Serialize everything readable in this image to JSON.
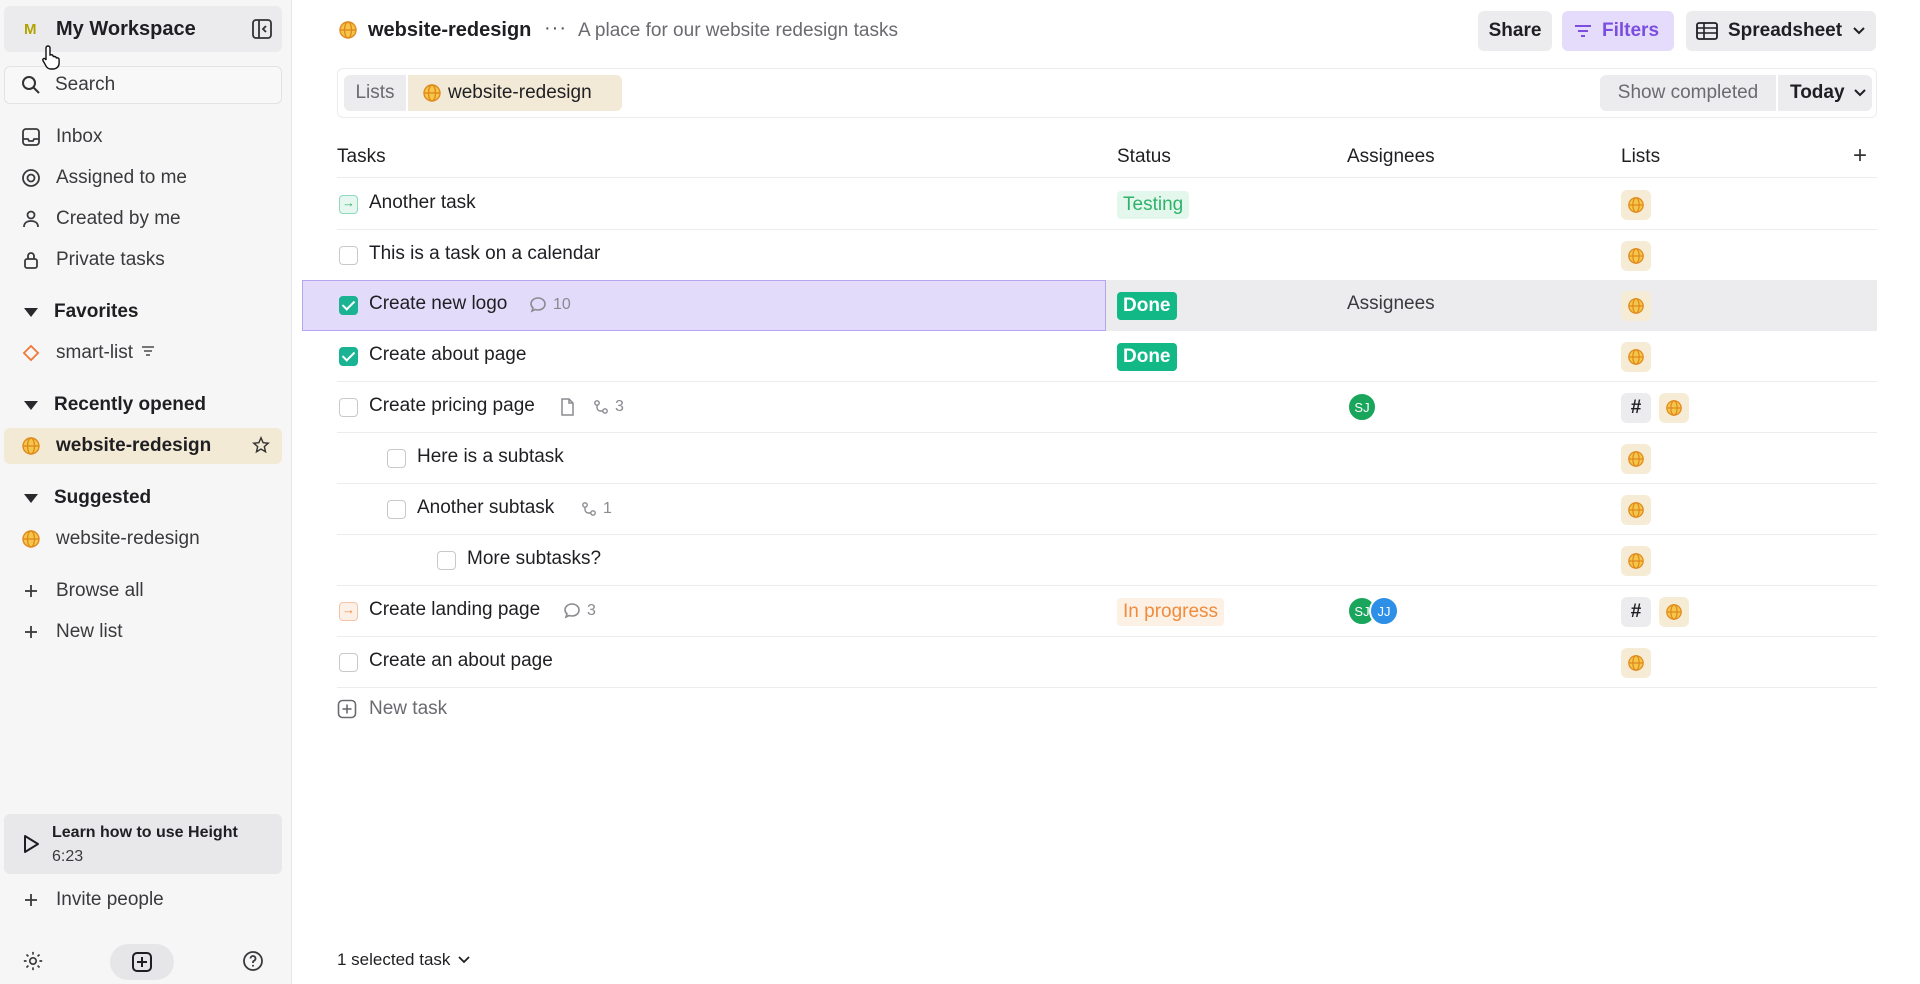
{
  "sidebar": {
    "workspace": {
      "avatar": "M",
      "name": "My Workspace"
    },
    "search": {
      "placeholder": "Search",
      "value": ""
    },
    "nav": [
      {
        "label": "Inbox",
        "icon": "inbox-icon"
      },
      {
        "label": "Assigned to me",
        "icon": "target-icon"
      },
      {
        "label": "Created by me",
        "icon": "person-icon"
      },
      {
        "label": "Private tasks",
        "icon": "lock-icon"
      }
    ],
    "favorites": {
      "title": "Favorites",
      "items": [
        {
          "label": "smart-list",
          "icon": "diamond-icon"
        }
      ]
    },
    "recent": {
      "title": "Recently opened",
      "items": [
        {
          "label": "website-redesign",
          "icon": "globe-icon"
        }
      ]
    },
    "suggested": {
      "title": "Suggested",
      "items": [
        {
          "label": "website-redesign",
          "icon": "globe-icon"
        }
      ]
    },
    "browse_all": "Browse all",
    "new_list": "New list",
    "learn": {
      "title": "Learn how to use Height",
      "duration": "6:23"
    },
    "invite": "Invite people"
  },
  "header": {
    "title": "website-redesign",
    "more": "···",
    "description": "A place for our website redesign tasks",
    "share": "Share",
    "filters": "Filters",
    "view": "Spreadsheet"
  },
  "filterbar": {
    "crumb_lists": "Lists",
    "crumb_project": "website-redesign",
    "show_completed": "Show completed",
    "date": "Today"
  },
  "table": {
    "columns": {
      "tasks": "Tasks",
      "status": "Status",
      "assignees": "Assignees",
      "lists": "Lists",
      "add": "+"
    },
    "rows": [
      {
        "name": "Another task",
        "status": "Testing",
        "state": "arrow-green"
      },
      {
        "name": "This is a task on a calendar",
        "state": "open"
      },
      {
        "name": "Create new logo",
        "status": "Done",
        "comments": "10",
        "assignees_text": "Assignees",
        "state": "checked"
      },
      {
        "name": "Create about page",
        "status": "Done",
        "state": "checked"
      },
      {
        "name": "Create pricing page",
        "subtasks": "3",
        "assignees": [
          "SJ"
        ],
        "state": "open"
      },
      {
        "name": "Here is a subtask",
        "state": "open"
      },
      {
        "name": "Another subtask",
        "subtasks": "1",
        "state": "open"
      },
      {
        "name": "More subtasks?",
        "state": "open"
      },
      {
        "name": "Create landing page",
        "status": "In progress",
        "comments": "3",
        "assignees": [
          "SJ",
          "JJ"
        ],
        "state": "arrow-orange"
      },
      {
        "name": "Create an about page",
        "state": "open"
      }
    ],
    "new_task": "New task"
  },
  "footer": {
    "selection": "1 selected task"
  },
  "colors": {
    "accent_purple": "#7b4ee0",
    "done_green": "#12b886",
    "testing_green": "#30b26a",
    "progress_orange": "#f08c3c",
    "selection": "#e2dbfa"
  }
}
